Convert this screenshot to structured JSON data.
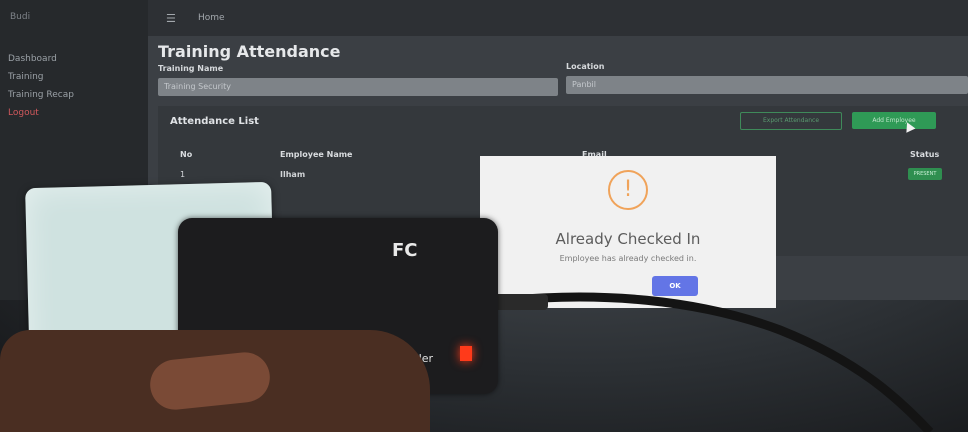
{
  "sidebar": {
    "brand": "Budi",
    "items": [
      {
        "label": "Dashboard"
      },
      {
        "label": "Training"
      },
      {
        "label": "Training Recap"
      },
      {
        "label": "Logout"
      }
    ]
  },
  "topbar": {
    "menu_icon": "menu-icon",
    "home": "Home"
  },
  "page": {
    "title": "Training Attendance",
    "training_name_label": "Training Name",
    "training_name_value": "Training Security",
    "location_label": "Location",
    "location_value": "Panbil"
  },
  "attendance": {
    "title": "Attendance List",
    "export_label": "Export Attendance",
    "add_label": "Add Employee",
    "columns": [
      "No",
      "Employee Name",
      "Email",
      "Status"
    ],
    "rows": [
      {
        "no": "1",
        "name": "Ilham",
        "status": "PRESENT"
      }
    ]
  },
  "modal": {
    "icon": "warning-icon",
    "title": "Already Checked In",
    "text": "Employee has already checked in.",
    "ok": "OK"
  },
  "device": {
    "logo": "FC",
    "label": "USB Reader"
  },
  "colors": {
    "ok_button": "#6375e6",
    "warning": "#f0a35a",
    "add_button": "#2f9a56",
    "led": "#ff3a1a"
  }
}
